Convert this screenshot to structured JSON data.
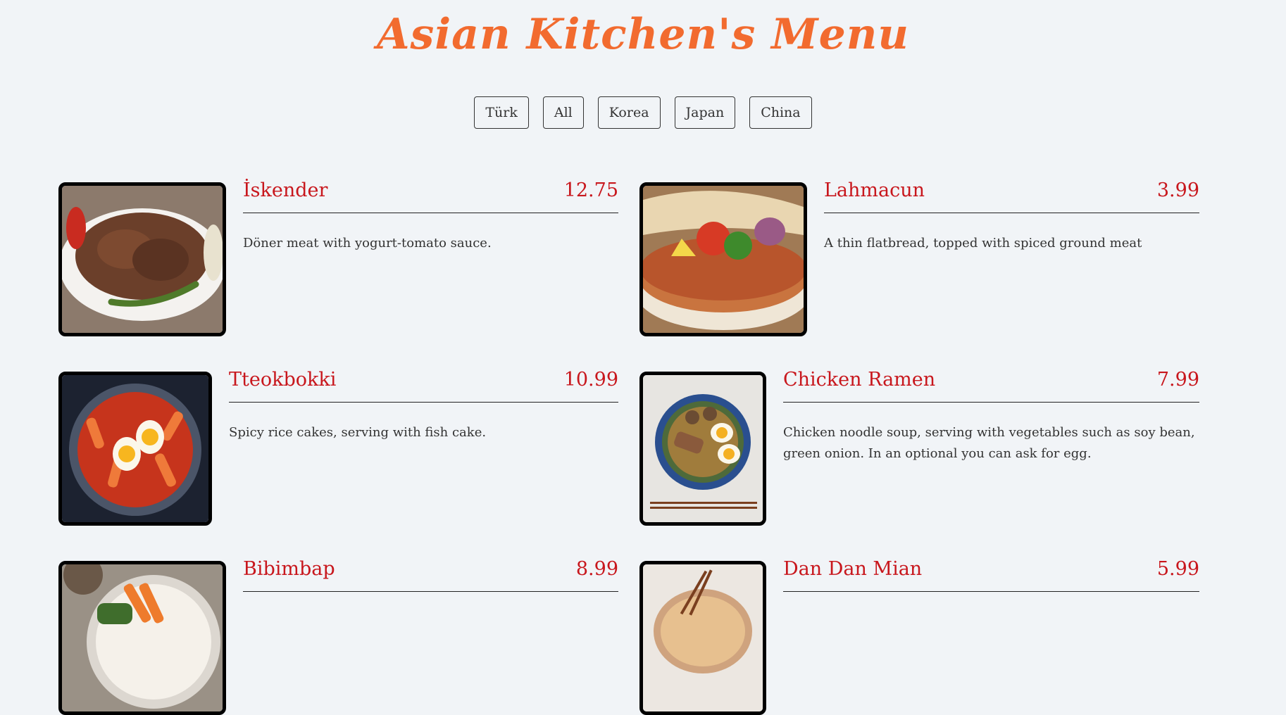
{
  "header": {
    "title": "Asian Kitchen's Menu"
  },
  "filters": [
    "Türk",
    "All",
    "Korea",
    "Japan",
    "China"
  ],
  "items": [
    {
      "name": "İskender",
      "price": "12.75",
      "desc": "Döner meat with yogurt-tomato sauce.",
      "icon": "iskender-photo"
    },
    {
      "name": "Lahmacun",
      "price": "3.99",
      "desc": "A thin flatbread, topped with spiced ground meat",
      "icon": "lahmacun-photo"
    },
    {
      "name": "Tteokbokki",
      "price": "10.99",
      "desc": "Spicy rice cakes, serving with fish cake.",
      "icon": "tteokbokki-photo"
    },
    {
      "name": "Chicken Ramen",
      "price": "7.99",
      "desc": "Chicken noodle soup, serving with vegetables such as soy bean, green onion. In an optional you can ask for egg.",
      "icon": "ramen-photo"
    },
    {
      "name": "Bibimbap",
      "price": "8.99",
      "desc": "",
      "icon": "bibimbap-photo"
    },
    {
      "name": "Dan Dan Mian",
      "price": "5.99",
      "desc": "",
      "icon": "dandanmian-photo"
    }
  ],
  "colors": {
    "background": "#f1f4f7",
    "title": "#f26b2f",
    "item_text": "#c8171d"
  }
}
